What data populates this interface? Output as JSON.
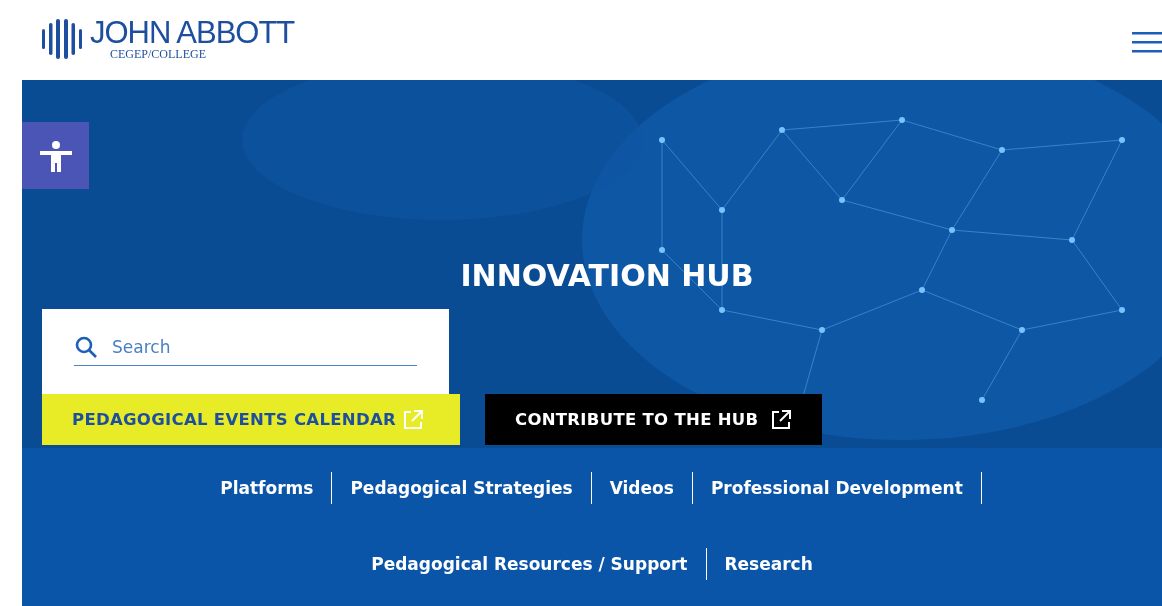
{
  "logo": {
    "name": "JOHN ABBOTT",
    "subtitle": "CEGEP/COLLEGE"
  },
  "hero": {
    "title": "INNOVATION HUB"
  },
  "search": {
    "placeholder": "Search"
  },
  "buttons": [
    {
      "label": "PEDAGOGICAL EVENTS CALENDAR",
      "kind": "highlight"
    },
    {
      "label": "CONTRIBUTE TO THE HUB",
      "kind": "dark"
    }
  ],
  "nav_links": [
    "Platforms",
    "Pedagogical Strategies",
    "Videos",
    "Professional Development",
    "Pedagogical Resources / Support",
    "Research"
  ]
}
